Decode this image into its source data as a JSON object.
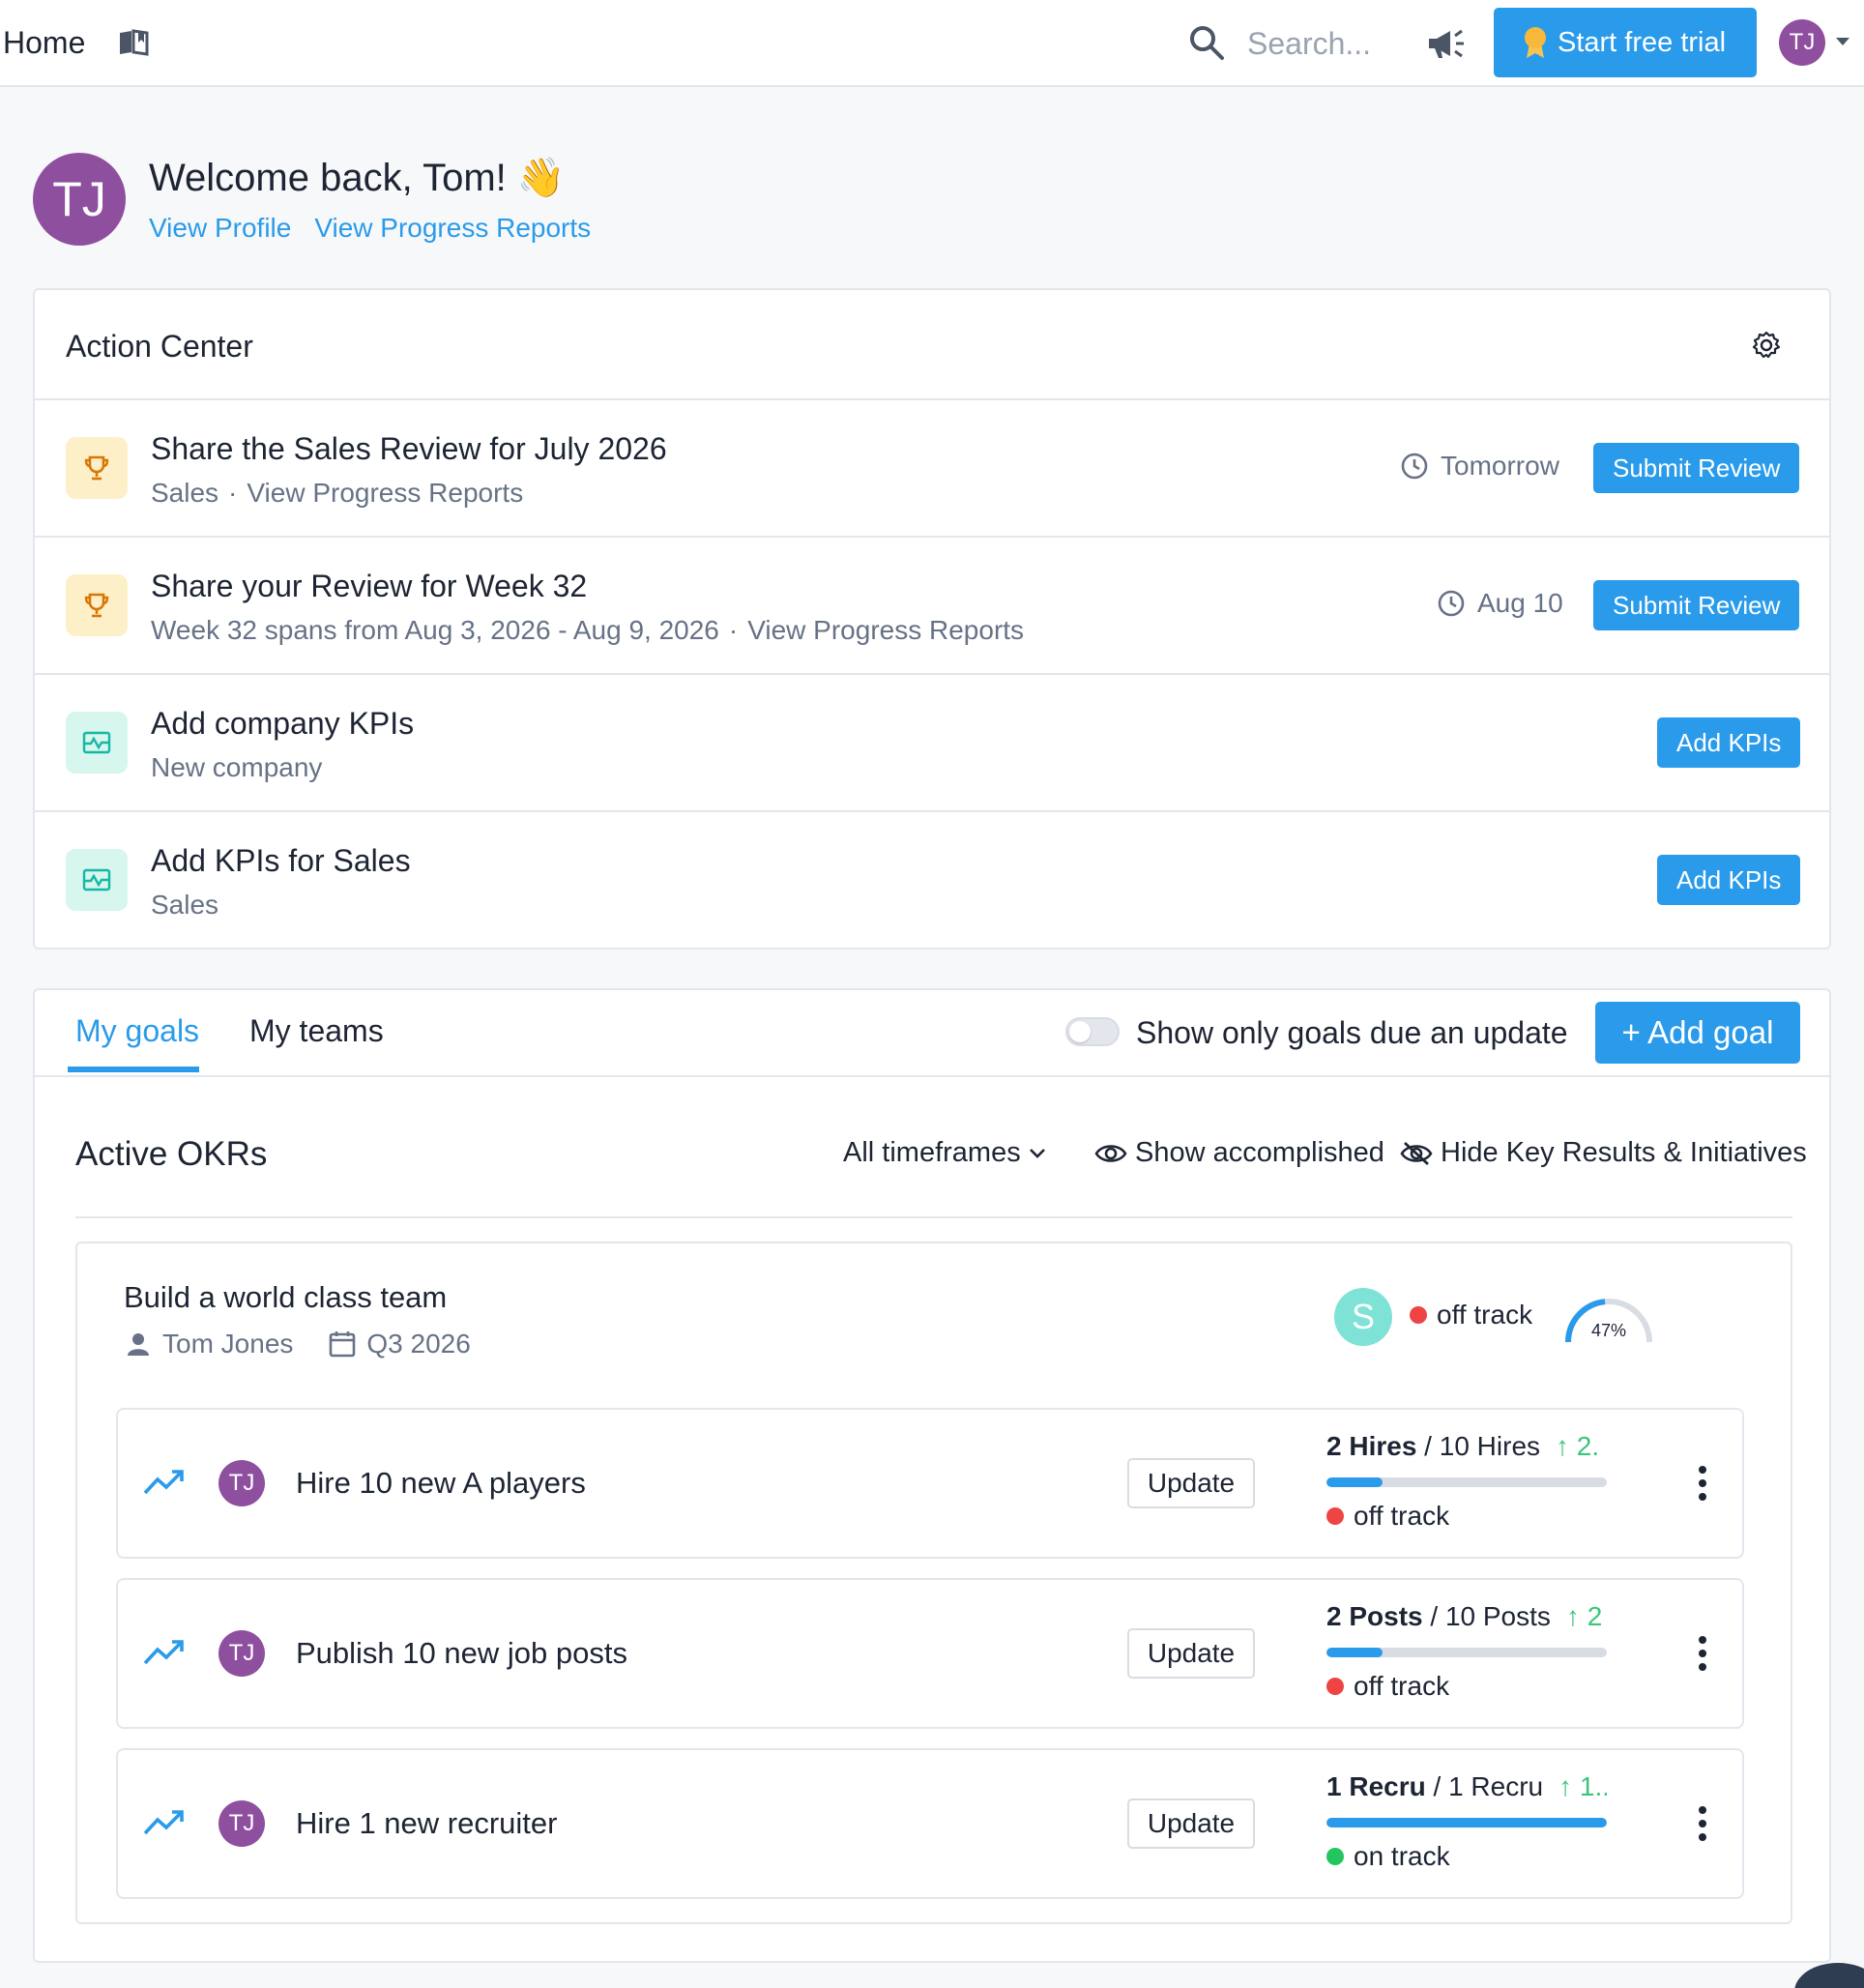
{
  "topbar": {
    "home_label": "Home",
    "search_placeholder": "Search...",
    "trial_label": "Start free trial",
    "avatar_initials": "TJ"
  },
  "welcome": {
    "avatar_initials": "TJ",
    "title": "Welcome back, Tom! 👋",
    "links": [
      "View Profile",
      "View Progress Reports"
    ]
  },
  "action_center": {
    "title": "Action Center",
    "items": [
      {
        "icon": "trophy-icon",
        "title": "Share the Sales Review for July 2026",
        "sub_main": "Sales",
        "sub_link": "View Progress Reports",
        "due": "Tomorrow",
        "button": "Submit Review"
      },
      {
        "icon": "trophy-icon",
        "title": "Share your Review for Week 32",
        "sub_main": "Week 32 spans from Aug 3, 2026 - Aug 9, 2026",
        "sub_link": "View Progress Reports",
        "due": "Aug 10",
        "button": "Submit Review"
      },
      {
        "icon": "kpi-icon",
        "title": "Add company KPIs",
        "sub_main": "New company",
        "button": "Add KPIs"
      },
      {
        "icon": "kpi-icon",
        "title": "Add KPIs for Sales",
        "sub_main": "Sales",
        "button": "Add KPIs"
      }
    ]
  },
  "goals": {
    "tabs": [
      "My goals",
      "My teams"
    ],
    "active_tab": "My goals",
    "toggle_label": "Show only goals due an update",
    "toggle_on": false,
    "add_goal_label": "+ Add goal",
    "section_title": "Active OKRs",
    "timeframe_label": "All timeframes",
    "show_accomplished_label": "Show accomplished",
    "hide_kr_label": "Hide Key Results & Initiatives",
    "objective": {
      "title": "Build a world class team",
      "owner": "Tom Jones",
      "period": "Q3 2026",
      "team_initial": "S",
      "status": "off track",
      "progress_pct": 47,
      "progress_label": "47%",
      "key_results": [
        {
          "title": "Hire 10 new A players",
          "avatar": "TJ",
          "update_label": "Update",
          "current": "2 Hires",
          "target": "10 Hires",
          "delta": "2.",
          "progress": 0.2,
          "status": "off track",
          "status_color": "#ef4444"
        },
        {
          "title": "Publish 10 new job posts",
          "avatar": "TJ",
          "update_label": "Update",
          "current": "2 Posts",
          "target": "10 Posts",
          "delta": "2",
          "progress": 0.2,
          "status": "off track",
          "status_color": "#ef4444"
        },
        {
          "title": "Hire 1 new recruiter",
          "avatar": "TJ",
          "update_label": "Update",
          "current": "1 Recru",
          "target": "1 Recru",
          "delta": "1..",
          "progress": 1.0,
          "status": "on track",
          "status_color": "#22c55e"
        }
      ]
    }
  },
  "colors": {
    "accent": "#2a9bea",
    "avatar": "#8e4f9f",
    "off_track": "#ef4444",
    "on_track": "#22c55e",
    "delta": "#3cc47c"
  }
}
